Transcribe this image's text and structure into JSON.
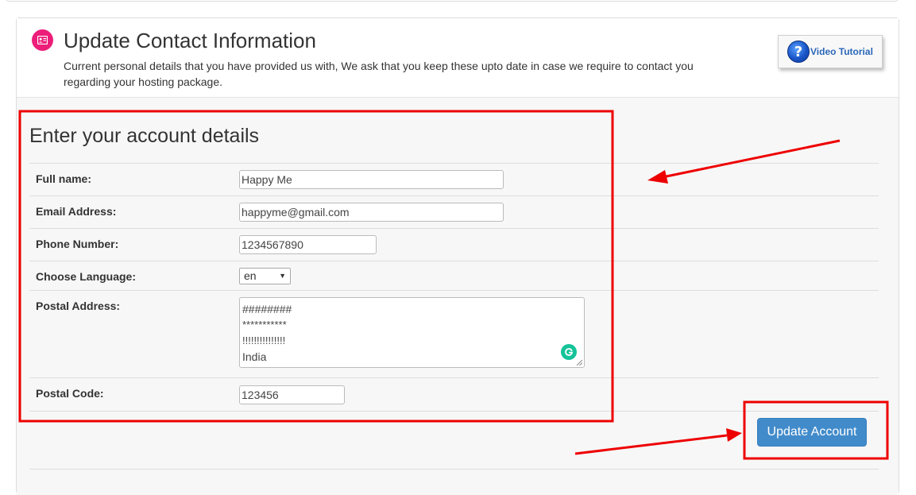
{
  "header": {
    "title": "Update Contact Information",
    "description": "Current personal details that you have provided us with, We ask that you keep these upto date in case we require to contact you regarding your hosting package.",
    "icon": "contact-card-icon",
    "icon_color": "#ec1e79",
    "video_tutorial_label": "Video Tutorial",
    "video_icon": "question-mark-icon"
  },
  "form": {
    "section_title": "Enter your account details",
    "full_name": {
      "label": "Full name:",
      "value": "Happy Me"
    },
    "email": {
      "label": "Email Address:",
      "value": "happyme@gmail.com"
    },
    "phone": {
      "label": "Phone Number:",
      "value": "1234567890"
    },
    "language": {
      "label": "Choose Language:",
      "selected": "en"
    },
    "postal_address": {
      "label": "Postal Address:",
      "lines": [
        "########",
        "***********",
        "!!!!!!!!!!!!!!!",
        "India"
      ]
    },
    "postal_code": {
      "label": "Postal Code:",
      "value": "123456"
    },
    "submit_label": "Update Account"
  },
  "colors": {
    "primary_button": "#428bca",
    "annotation": "#ee0000",
    "grammarly": "#15c39a",
    "body_background": "#f7f7f7"
  }
}
